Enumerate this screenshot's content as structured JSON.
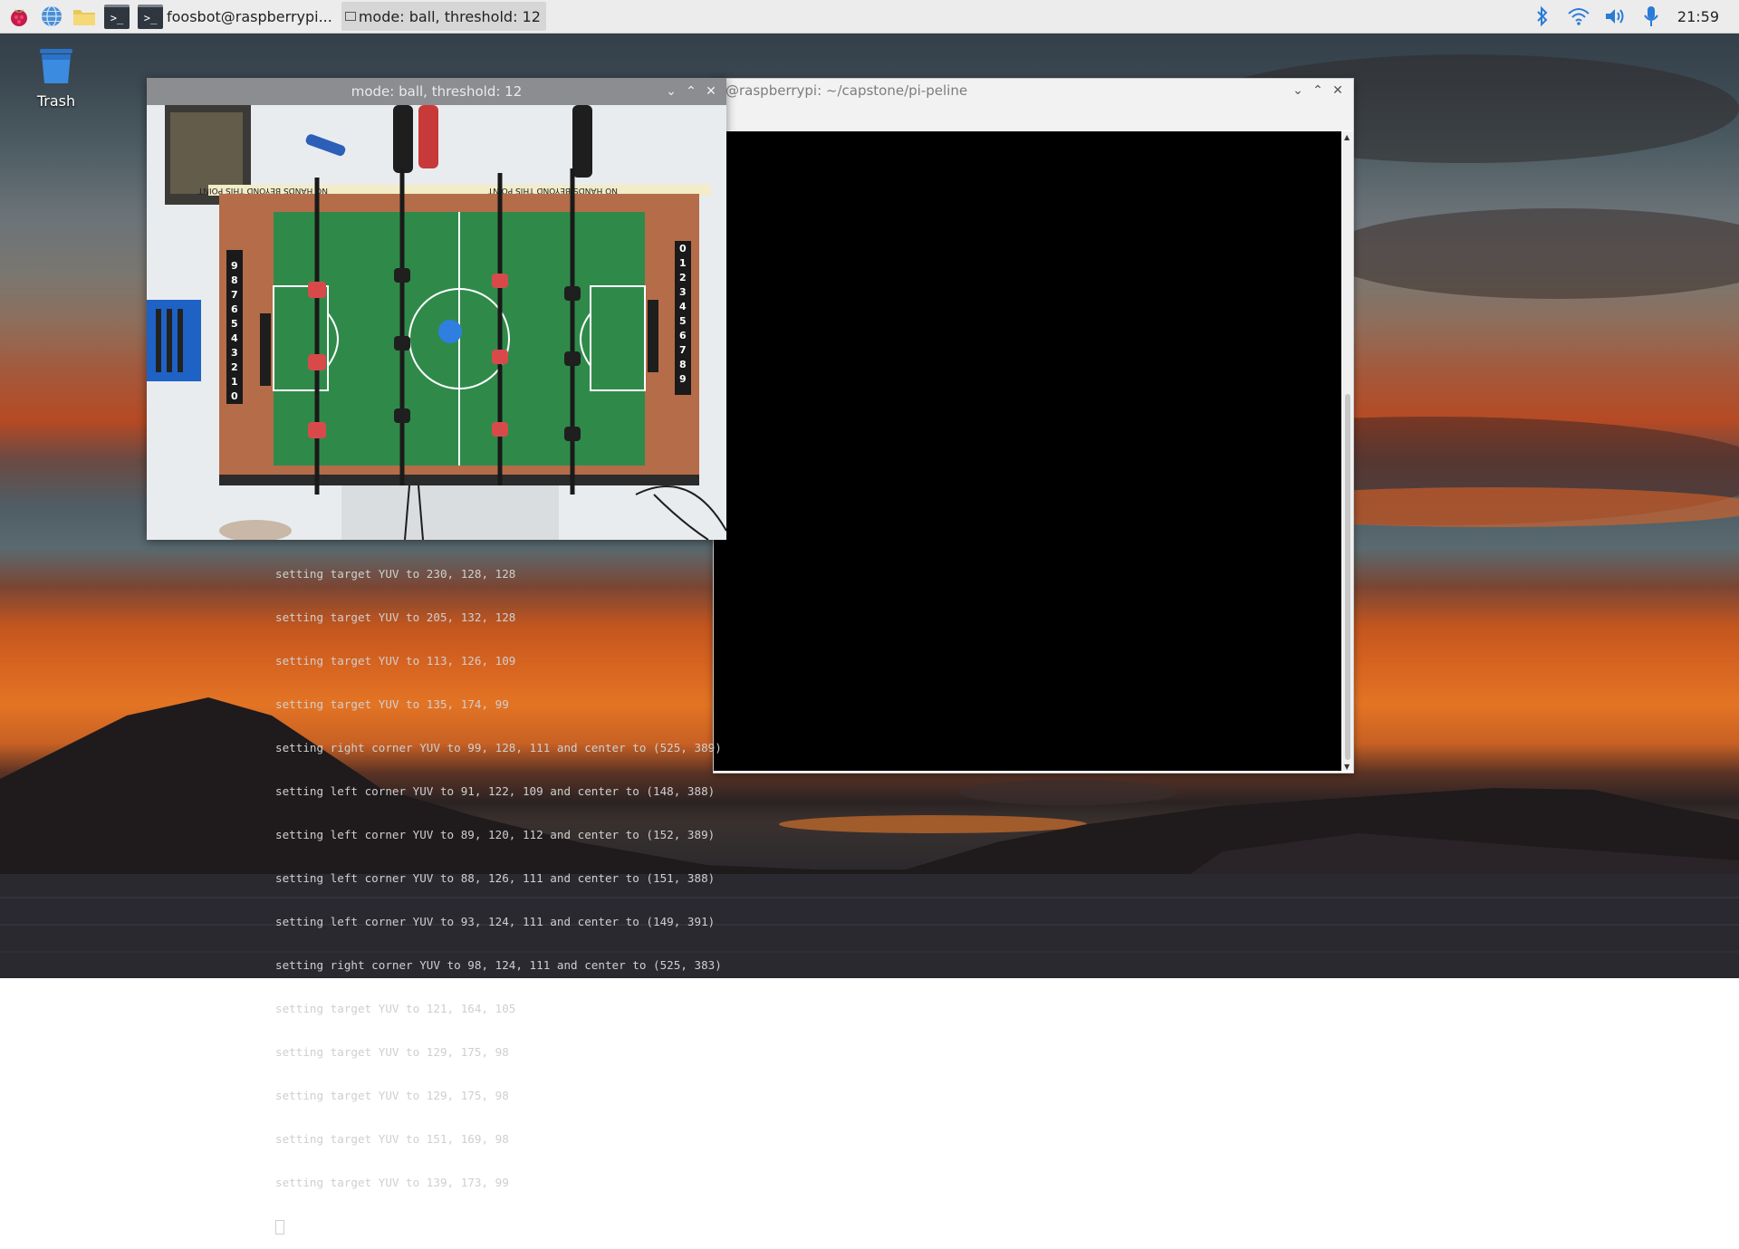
{
  "taskbar": {
    "tasks": [
      {
        "label": "foosbot@raspberrypi...",
        "active": false
      },
      {
        "label": "mode: ball, threshold: 12",
        "active": true
      }
    ],
    "clock": "21:59"
  },
  "desktop": {
    "trash_label": "Trash"
  },
  "terminal": {
    "title": "@raspberrypi: ~/capstone/pi-peline",
    "lines": [
      "setting target YUV to 230, 128, 128",
      "setting target YUV to 205, 132, 128",
      "setting target YUV to 113, 126, 109",
      "setting target YUV to 135, 174, 99",
      "setting right corner YUV to 99, 128, 111 and center to (525, 389)",
      "setting left corner YUV to 91, 122, 109 and center to (148, 388)",
      "setting left corner YUV to 89, 120, 112 and center to (152, 389)",
      "setting left corner YUV to 88, 126, 111 and center to (151, 388)",
      "setting left corner YUV to 93, 124, 111 and center to (149, 391)",
      "setting right corner YUV to 98, 124, 111 and center to (525, 383)",
      "setting target YUV to 121, 164, 105",
      "setting target YUV to 129, 175, 98",
      "setting target YUV to 129, 175, 98",
      "setting target YUV to 151, 169, 98",
      "setting target YUV to 139, 173, 99"
    ]
  },
  "camera": {
    "title": "mode: ball, threshold: 12",
    "banner_text": "NO HANDS BEYOND THIS POINT",
    "score_digits": [
      "0",
      "1",
      "2",
      "3",
      "4",
      "5",
      "6",
      "7",
      "8",
      "9"
    ]
  },
  "colors": {
    "terminal_bg": "#000000",
    "terminal_fg": "#cfcfcf",
    "field_green": "#2f8a4a",
    "ball_blue": "#2f7fe0"
  }
}
